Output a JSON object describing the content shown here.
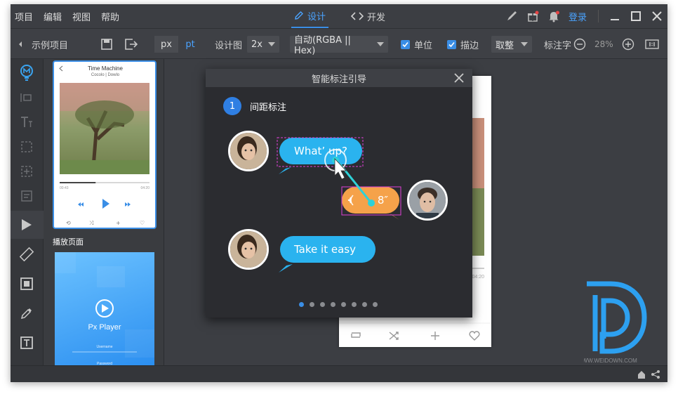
{
  "menu": {
    "items": [
      "项目",
      "编辑",
      "视图",
      "帮助"
    ]
  },
  "modes": {
    "design": "设计",
    "develop": "开发"
  },
  "titlebar": {
    "login": "登录"
  },
  "toolbar": {
    "project": "示例项目",
    "unit_px": "px",
    "unit_pt": "pt",
    "design_label": "设计图",
    "design_scale": "2x",
    "color_format": "自动(RGBA || Hex)",
    "unit_label": "单位",
    "stroke_label": "描边",
    "rounding": "取整",
    "annotation_label": "标注字",
    "zoom": "28%"
  },
  "thumbs": {
    "page1_label": "播放页面",
    "song_title": "Time Machine",
    "song_artist": "Cocolo | Dowlo",
    "time_start": "00:43",
    "time_end": "04:20",
    "player_title": "Px Player",
    "username": "Username",
    "password": "Password",
    "progress": 0.4
  },
  "dialog": {
    "title": "智能标注引导",
    "step_number": "1",
    "step_label": "间距标注",
    "bubble1": "What’ up?",
    "bubble2": "8″",
    "bubble3": "Take it easy",
    "dot_count": 8,
    "active_dot": 0
  },
  "artboard": {
    "time_end": "04:20"
  },
  "colors": {
    "accent": "#3a8ee6",
    "bubble_blue": "#2ab3ef",
    "bubble_orange": "#f5a24a",
    "measure_magenta": "#e040d8",
    "cursor_cyan": "#2ed2d8"
  },
  "watermark": {
    "text": "WWW.WEIDOWN.COM"
  }
}
